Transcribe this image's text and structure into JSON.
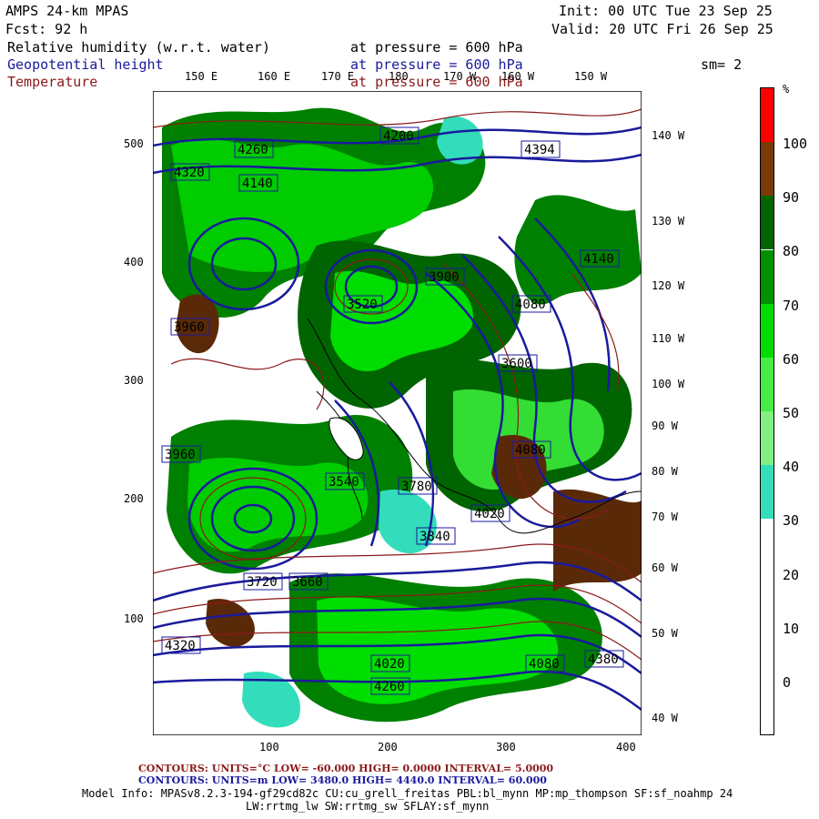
{
  "header": {
    "model": "AMPS 24-km MPAS",
    "fcst": "Fcst:   92 h",
    "init": "Init: 00 UTC Tue 23 Sep 25",
    "valid": "Valid: 20 UTC Fri 26 Sep 25",
    "sm": "sm= 2"
  },
  "fields": [
    {
      "name": "Relative humidity (w.r.t. water)",
      "level": "at pressure =  600 hPa",
      "color": "#000000"
    },
    {
      "name": "Geopotential height",
      "level": "at pressure =  600 hPa",
      "color": "#1a1a9c"
    },
    {
      "name": "Temperature",
      "level": "at pressure =  600 hPa",
      "color": "#8b1a1a"
    }
  ],
  "longitude_labels_top": [
    "150 E",
    "160 E",
    "170 E",
    "180",
    "170 W",
    "160 W",
    "150 W"
  ],
  "longitude_labels_right": [
    "140 W",
    "130 W",
    "120 W",
    "110 W",
    "100 W",
    "90 W",
    "80 W",
    "70 W",
    "60 W",
    "50 W",
    "40 W"
  ],
  "y_axis_labels": [
    "500",
    "400",
    "300",
    "200",
    "100"
  ],
  "x_axis_labels": [
    "100",
    "200",
    "300",
    "400"
  ],
  "colorbar": {
    "unit": "%",
    "labels": [
      "100",
      "90",
      "80",
      "70",
      "60",
      "50",
      "40",
      "30",
      "20",
      "10",
      "0"
    ],
    "colors": [
      "#ff0000",
      "#7a3a08",
      "#006400",
      "#009000",
      "#00dd00",
      "#44ee44",
      "#80f080",
      "#33ddbb",
      "#ffffff",
      "#ffffff",
      "#ffffff",
      "#ffffff"
    ]
  },
  "contour_labels": [
    "4320",
    "4260",
    "4320",
    "4140",
    "4200",
    "4080",
    "4020",
    "4080",
    "3960",
    "3900",
    "3840",
    "3780",
    "3720",
    "3660",
    "3600",
    "3540",
    "3960",
    "4394",
    "3520",
    "4380",
    "4260",
    "4140",
    "4020",
    "4080"
  ],
  "footer": {
    "line1_red": "CONTOURS:  UNITS=°C  LOW=  -60.000        HIGH=  0.0000         INTERVAL=   5.0000",
    "line2_blue": "CONTOURS:  UNITS=m  LOW=  3480.0        HIGH=  4440.0         INTERVAL=   60.000",
    "model_info": "Model Info: MPASv8.2.3-194-gf29cd82c CU:cu_grell_freitas PBL:bl_mynn MP:mp_thompson SF:sf_noahmp 24",
    "model_info2": "LW:rrtmg_lw SW:rrtmg_sw SFLAY:sf_mynn"
  }
}
